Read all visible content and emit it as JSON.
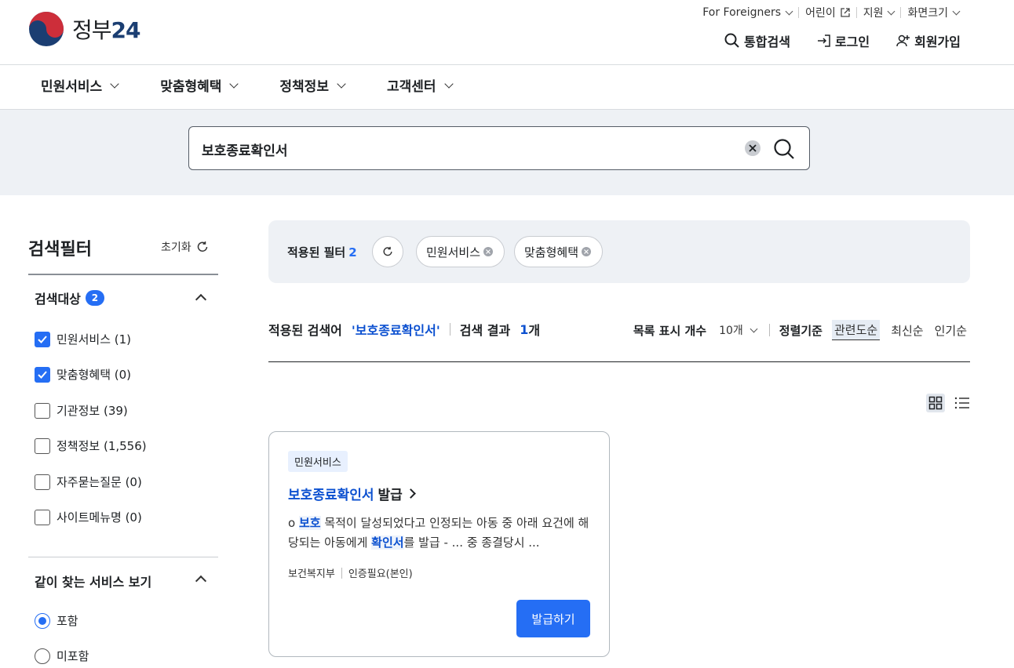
{
  "header": {
    "logo_text": "정부",
    "logo_num": "24",
    "utility": [
      {
        "label": "For Foreigners",
        "icon": "chevron-down-icon"
      },
      {
        "label": "어린이",
        "icon": "external-link-icon"
      },
      {
        "label": "지원",
        "icon": "chevron-down-icon"
      },
      {
        "label": "화면크기",
        "icon": "chevron-down-icon"
      }
    ],
    "main_menu": [
      {
        "label": "통합검색",
        "icon": "search-icon"
      },
      {
        "label": "로그인",
        "icon": "login-icon"
      },
      {
        "label": "회원가입",
        "icon": "user-add-icon"
      }
    ]
  },
  "gnb": [
    "민원서비스",
    "맞춤형혜택",
    "정책정보",
    "고객센터"
  ],
  "search": {
    "value": "보호종료확인서"
  },
  "filter": {
    "title": "검색필터",
    "reset_label": "초기화",
    "target": {
      "title": "검색대상",
      "count": "2",
      "options": [
        {
          "label": "민원서비스 (1)",
          "checked": true
        },
        {
          "label": "맞춤형혜택 (0)",
          "checked": true
        },
        {
          "label": "기관정보 (39)",
          "checked": false
        },
        {
          "label": "정책정보 (1,556)",
          "checked": false
        },
        {
          "label": "자주묻는질문 (0)",
          "checked": false
        },
        {
          "label": "사이트메뉴명 (0)",
          "checked": false
        }
      ]
    },
    "related": {
      "title": "같이 찾는 서비스 보기",
      "options": [
        {
          "label": "포함",
          "selected": true
        },
        {
          "label": "미포함",
          "selected": false
        }
      ]
    }
  },
  "applied": {
    "label": "적용된 필터",
    "count": "2",
    "chips": [
      "민원서비스",
      "맞춤형혜택"
    ]
  },
  "summary": {
    "label": "적용된 검색어",
    "query": "'보호종료확인서'",
    "result_label": "검색 결과",
    "result_count": "1",
    "result_unit": "개"
  },
  "options": {
    "per_page_label": "목록 표시 개수",
    "per_page_value": "10개",
    "sort_label": "정렬기준",
    "sorts": [
      "관련도순",
      "최신순",
      "인기순"
    ],
    "active_sort": "관련도순"
  },
  "card": {
    "tag": "민원서비스",
    "title_highlight": "보호종료확인서",
    "title_rest": "발급",
    "desc_prefix": "o ",
    "desc_mark1": "보호",
    "desc_mid": " 목적이 달성되었다고 인정되는 아동 중 아래 요건에 해당되는 아동에게 ",
    "desc_mark2": "확인서",
    "desc_suffix": "를 발급 - ... 중 종결당시 ...",
    "agency": "보건복지부",
    "auth": "인증필요(본인)",
    "button": "발급하기"
  },
  "colors": {
    "accent": "#256ef4",
    "highlight": "#0b50d0",
    "band": "#eef1f5"
  }
}
